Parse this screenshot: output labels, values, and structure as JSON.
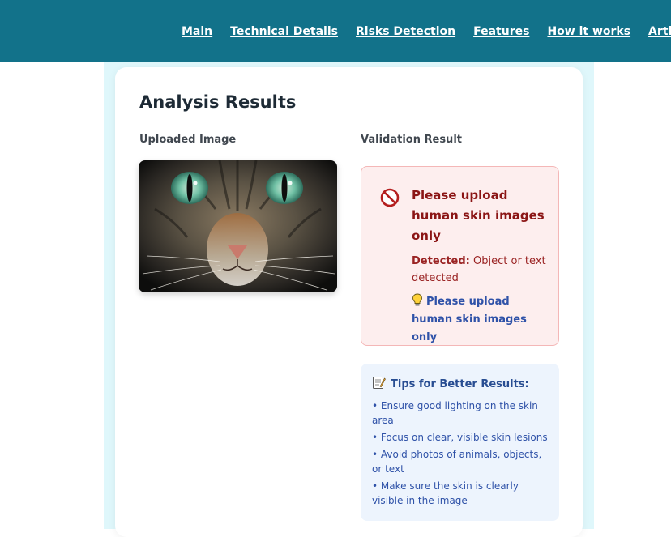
{
  "nav": {
    "items": [
      "Main",
      "Technical Details",
      "Risks Detection",
      "Features",
      "How it works",
      "Artificial Intelligence"
    ]
  },
  "card": {
    "title": "Analysis Results",
    "uploaded_label": "Uploaded Image",
    "validation_label": "Validation Result"
  },
  "validation": {
    "message": "Please upload human skin images only",
    "detected_label": "Detected:",
    "detected_value": "Object or text detected",
    "hint": "Please upload human skin images only"
  },
  "tips": {
    "title": "Tips for Better Results:",
    "items": [
      "• Ensure good lighting on the skin area",
      "• Focus on clear, visible skin lesions",
      "• Avoid photos of animals, objects, or text",
      "• Make sure the skin is clearly visible in the image"
    ]
  },
  "colors": {
    "header": "#12728a",
    "error_bg": "#fdeeee",
    "error_text": "#8b1515",
    "hint_text": "#2f52a8",
    "tips_bg": "#edf4fd"
  },
  "icons": {
    "error": "prohibited-icon",
    "hint": "lightbulb-icon",
    "tips": "memo-icon"
  }
}
